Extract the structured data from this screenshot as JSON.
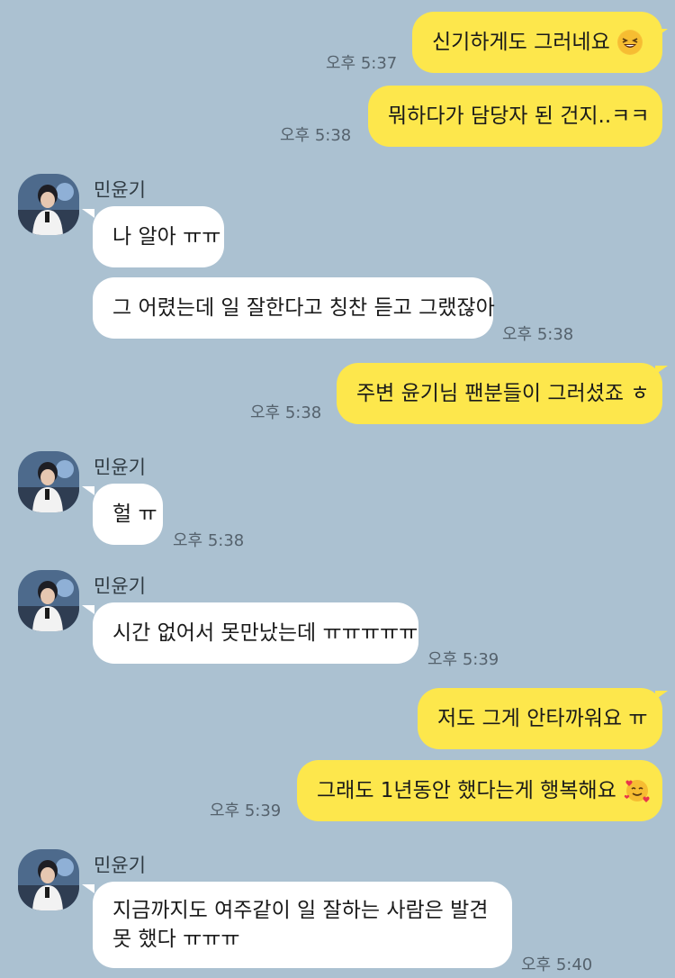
{
  "contact": {
    "name": "민윤기"
  },
  "colors": {
    "background": "#abc1d1",
    "my_bubble": "#fde74c",
    "their_bubble": "#ffffff"
  },
  "messages": [
    {
      "from": "me",
      "text": "신기하게도 그러네요",
      "emoji": "grinning-squinting-face",
      "time": "오후 5:37"
    },
    {
      "from": "me",
      "text": "뭐하다가 담당자 된 건지..ㅋㅋ",
      "time": "오후 5:38"
    },
    {
      "from": "them",
      "sender": "민윤기",
      "text": "나 알아 ㅠㅠ"
    },
    {
      "from": "them",
      "text": "그 어렸는데 일 잘한다고 칭찬 듣고 그랬잖아",
      "time": "오후 5:38"
    },
    {
      "from": "me",
      "text": "주변 윤기님 팬분들이 그러셨죠 ㅎ",
      "time": "오후 5:38"
    },
    {
      "from": "them",
      "sender": "민윤기",
      "text": "헐 ㅠ",
      "time": "오후 5:38"
    },
    {
      "from": "them",
      "sender": "민윤기",
      "text": "시간 없어서 못만났는데 ㅠㅠㅠㅠㅠ",
      "time": "오후 5:39"
    },
    {
      "from": "me",
      "text": "저도 그게 안타까워요 ㅠ"
    },
    {
      "from": "me",
      "text": "그래도 1년동안 했다는게 행복해요",
      "emoji": "smiling-face-with-hearts",
      "time": "오후 5:39"
    },
    {
      "from": "them",
      "sender": "민윤기",
      "text": "지금까지도 여주같이 일 잘하는 사람은 발견 못 했다 ㅠㅠㅠ",
      "time": "오후 5:40"
    }
  ]
}
